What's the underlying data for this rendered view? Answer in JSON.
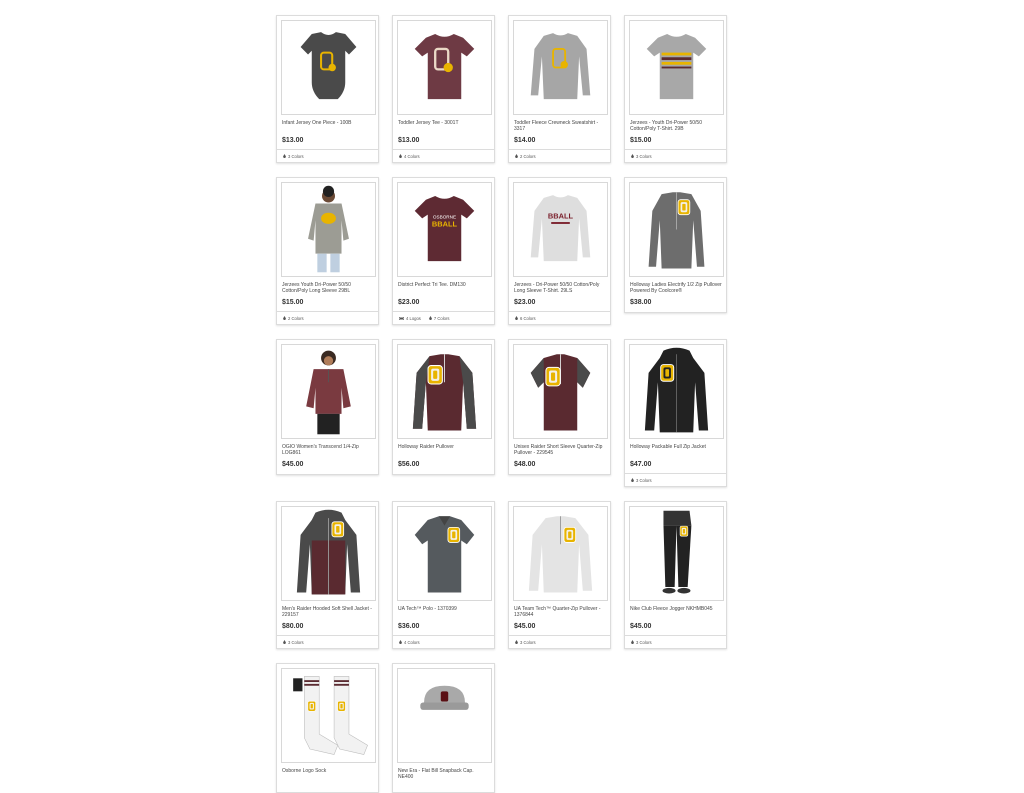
{
  "products": [
    {
      "name": "Infant Jersey One Piece - 100B",
      "price": "$13.00",
      "art": "onesie",
      "colors": "3 Colors"
    },
    {
      "name": "Toddler Jersey Tee - 3001T",
      "price": "$13.00",
      "art": "tee_maroon",
      "colors": "4 Colors"
    },
    {
      "name": "Toddler Fleece Crewneck Sweatshirt - 3317",
      "price": "$14.00",
      "art": "crew_gray",
      "colors": "2 Colors"
    },
    {
      "name": "Jerzees - Youth Dri-Power 50/50 Cotton/Poly T-Shirt. 29B",
      "price": "$15.00",
      "art": "tee_gray_stripe",
      "colors": "3 Colors"
    },
    {
      "name": "Jerzees Youth Dri-Power 50/50 Cotton/Poly Long Sleeve 29BL",
      "price": "$15.00",
      "art": "boy_longsleeve",
      "colors": "2 Colors"
    },
    {
      "name": "District Perfect Tri Tee. DM130",
      "price": "$23.00",
      "art": "tee_basketball",
      "logos": "4 Logos",
      "colors": "7 Colors"
    },
    {
      "name": "Jerzees - Dri-Power 50/50 Cotton/Poly Long Sleeve T-Shirt. 29LS",
      "price": "$23.00",
      "art": "longsleeve_basketball",
      "colors": "6 Colors"
    },
    {
      "name": "Holloway Ladies Electrify 1/2 Zip Pullover Powered By Coolcore®",
      "price": "$38.00",
      "art": "halfzip_heather"
    },
    {
      "name": "OGIO Women's Transcend 1/4-Zip LOG861",
      "price": "$45.00",
      "art": "woman_quarterzip"
    },
    {
      "name": "Holloway Raider Pullover",
      "price": "$56.00",
      "art": "pullover_maroon"
    },
    {
      "name": "Unisex Raider Short Sleeve Quarter-Zip Pullover - 229545",
      "price": "$48.00",
      "art": "shortsleeve_zip"
    },
    {
      "name": "Holloway Packable Full Zip Jacket",
      "price": "$47.00",
      "art": "jacket_black",
      "colors": "3 Colors"
    },
    {
      "name": "Men's Raider Hooded Soft Shell Jacket - 229157",
      "price": "$80.00",
      "art": "softshell",
      "colors": "3 Colors"
    },
    {
      "name": "UA Tech™ Polo - 1370399",
      "price": "$36.00",
      "art": "polo",
      "colors": "4 Colors"
    },
    {
      "name": "UA Team Tech™ Quarter-Zip Pullover - 1376844",
      "price": "$45.00",
      "art": "ua_quarterzip",
      "colors": "3 Colors"
    },
    {
      "name": "Nike Club Fleece Jogger NKHMB045",
      "price": "$45.00",
      "art": "jogger",
      "colors": "3 Colors"
    },
    {
      "name": "Osborne Logo Sock",
      "price": "",
      "art": "socks"
    },
    {
      "name": "New Era - Flat Bill Snapback Cap. NE400",
      "price": "",
      "art": "cap"
    }
  ]
}
